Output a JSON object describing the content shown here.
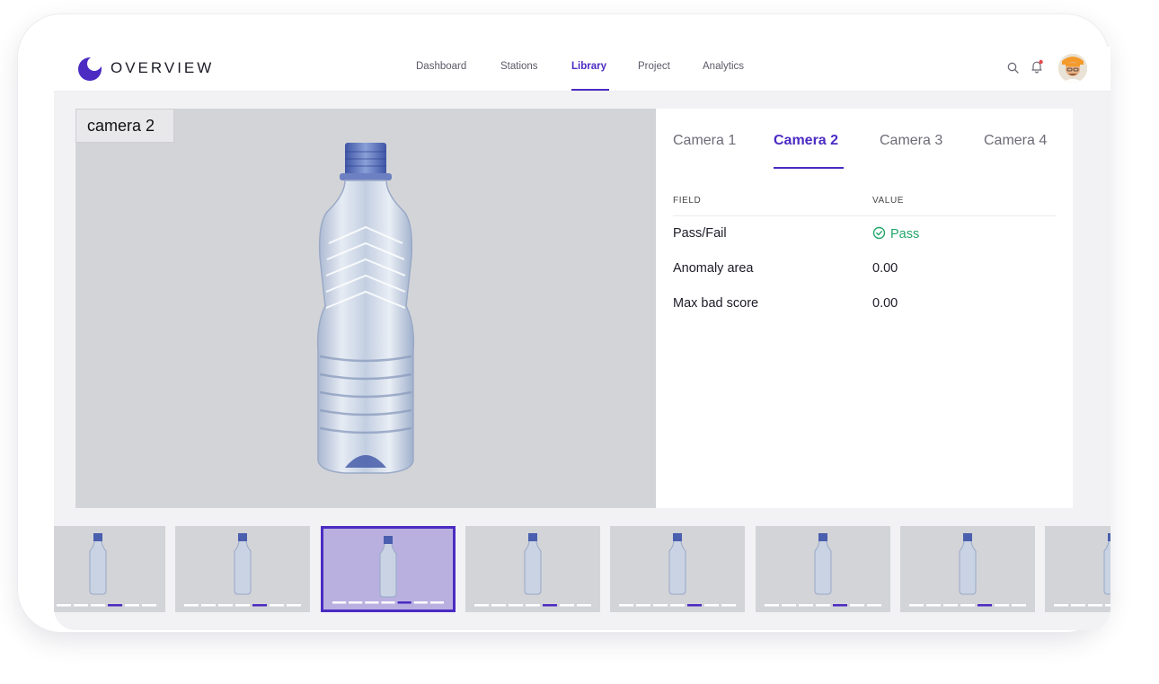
{
  "brand": {
    "name": "OVERVIEW",
    "logo_icon": "overview-logo-icon",
    "accent": "#4b2bc2"
  },
  "nav": {
    "items": [
      {
        "label": "Dashboard",
        "active": false
      },
      {
        "label": "Stations",
        "active": false
      },
      {
        "label": "Library",
        "active": true
      },
      {
        "label": "Project",
        "active": false
      },
      {
        "label": "Analytics",
        "active": false
      }
    ]
  },
  "header_icons": [
    "search-icon",
    "bell-icon"
  ],
  "notification_dot_color": "#e5484d",
  "viewer": {
    "camera_label": "camera 2"
  },
  "panel": {
    "tabs": [
      {
        "label": "Camera 1",
        "active": false
      },
      {
        "label": "Camera 2",
        "active": true
      },
      {
        "label": "Camera 3",
        "active": false
      },
      {
        "label": "Camera 4",
        "active": false
      }
    ],
    "columns": {
      "field": "FIELD",
      "value": "VALUE"
    },
    "rows": [
      {
        "field": "Pass/Fail",
        "value": "Pass",
        "status": "pass",
        "icon": "check-circle-icon"
      },
      {
        "field": "Anomaly area",
        "value": "0.00"
      },
      {
        "field": "Max bad score",
        "value": "0.00"
      }
    ],
    "pass_color": "#22a56a"
  },
  "filmstrip": {
    "selected_index": 2,
    "thumbnails": 8
  }
}
